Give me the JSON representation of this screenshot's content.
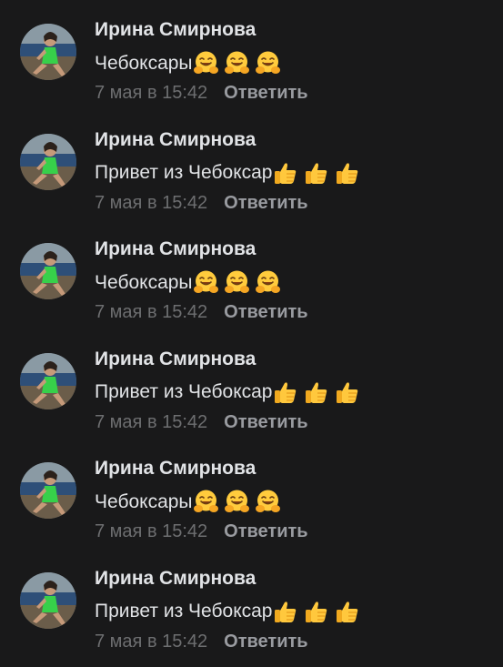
{
  "comments": [
    {
      "author": "Ирина Смирнова",
      "text": "Чебоксары",
      "emoji": [
        "hugging-face-emoji",
        "hugging-face-emoji",
        "hugging-face-emoji"
      ],
      "timestamp": "7 мая в 15:42",
      "reply_label": "Ответить"
    },
    {
      "author": "Ирина Смирнова",
      "text": "Привет из Чебоксар",
      "emoji": [
        "thumbs-up-emoji",
        "thumbs-up-emoji",
        "thumbs-up-emoji"
      ],
      "timestamp": "7 мая в 15:42",
      "reply_label": "Ответить"
    },
    {
      "author": "Ирина Смирнова",
      "text": "Чебоксары",
      "emoji": [
        "hugging-face-emoji",
        "hugging-face-emoji",
        "hugging-face-emoji"
      ],
      "timestamp": "7 мая в 15:42",
      "reply_label": "Ответить"
    },
    {
      "author": "Ирина Смирнова",
      "text": "Привет из Чебоксар",
      "emoji": [
        "thumbs-up-emoji",
        "thumbs-up-emoji",
        "thumbs-up-emoji"
      ],
      "timestamp": "7 мая в 15:42",
      "reply_label": "Ответить"
    },
    {
      "author": "Ирина Смирнова",
      "text": "Чебоксары",
      "emoji": [
        "hugging-face-emoji",
        "hugging-face-emoji",
        "hugging-face-emoji"
      ],
      "timestamp": "7 мая в 15:42",
      "reply_label": "Ответить"
    },
    {
      "author": "Ирина Смирнова",
      "text": "Привет из Чебоксар",
      "emoji": [
        "thumbs-up-emoji",
        "thumbs-up-emoji",
        "thumbs-up-emoji"
      ],
      "timestamp": "7 мая в 15:42",
      "reply_label": "Ответить"
    }
  ],
  "colors": {
    "background": "#19191a",
    "author": "#e1e3e6",
    "timestamp": "#6d6e70",
    "reply": "#999ba0"
  }
}
